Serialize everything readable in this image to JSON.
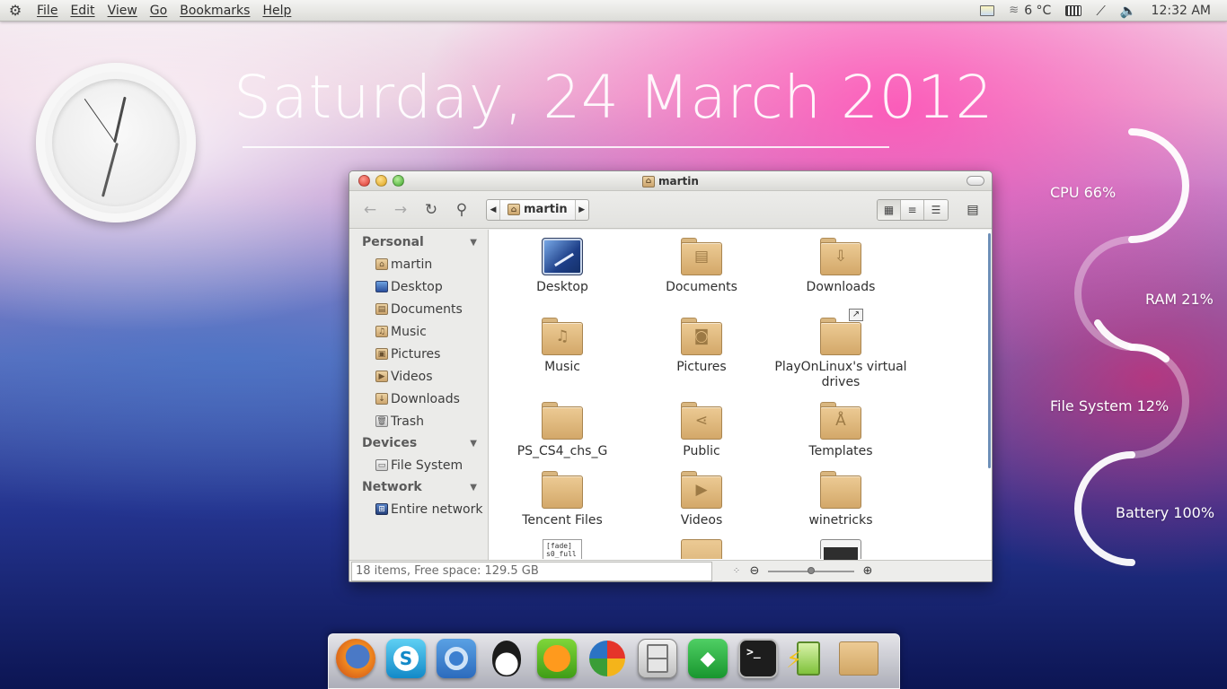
{
  "top_panel": {
    "menus": [
      "File",
      "Edit",
      "View",
      "Go",
      "Bookmarks",
      "Help"
    ],
    "temperature": "6 °C",
    "time": "12:32 AM",
    "icons": [
      "system-gear-icon",
      "weather-icon",
      "clouds-icon",
      "keyboard-icon",
      "network-icon",
      "volume-icon"
    ]
  },
  "desktop": {
    "date": "Saturday, 24 March 2012",
    "system_monitor": {
      "cpu": "CPU 66%",
      "ram": "RAM 21%",
      "file_system": "File System 12%",
      "battery": "Battery 100%"
    }
  },
  "window": {
    "title": "martin",
    "path_crumb": "martin",
    "sidebar": {
      "personal_header": "Personal",
      "personal_items": [
        "martin",
        "Desktop",
        "Documents",
        "Music",
        "Pictures",
        "Videos",
        "Downloads",
        "Trash"
      ],
      "devices_header": "Devices",
      "devices_items": [
        "File System"
      ],
      "network_header": "Network",
      "network_items": [
        "Entire network"
      ]
    },
    "files": [
      {
        "name": "Desktop",
        "icon": "desktop-folder"
      },
      {
        "name": "Documents",
        "icon": "documents-folder"
      },
      {
        "name": "Downloads",
        "icon": "downloads-folder"
      },
      {
        "name": "Music",
        "icon": "music-folder"
      },
      {
        "name": "Pictures",
        "icon": "pictures-folder"
      },
      {
        "name": "PlayOnLinux's virtual drives",
        "icon": "folder-symlink"
      },
      {
        "name": "PS_CS4_chs_G",
        "icon": "folder"
      },
      {
        "name": "Public",
        "icon": "public-folder"
      },
      {
        "name": "Templates",
        "icon": "templates-folder"
      },
      {
        "name": "Tencent Files",
        "icon": "folder"
      },
      {
        "name": "Videos",
        "icon": "videos-folder"
      },
      {
        "name": "winetricks",
        "icon": "folder"
      }
    ],
    "partial_doc_text": "[fade]\ns0_full",
    "status": "18 items, Free space: 129.5 GB",
    "zoom_level": 0.5
  },
  "dock": {
    "apps": [
      "firefox",
      "skype",
      "chromium",
      "qq",
      "pps",
      "pinwheel",
      "file-cabinet",
      "gem",
      "terminal",
      "power",
      "folder"
    ],
    "terminal_prompt": ">_"
  },
  "colors": {
    "folder": "#d9b67f",
    "accent": "#6d8fb8"
  }
}
